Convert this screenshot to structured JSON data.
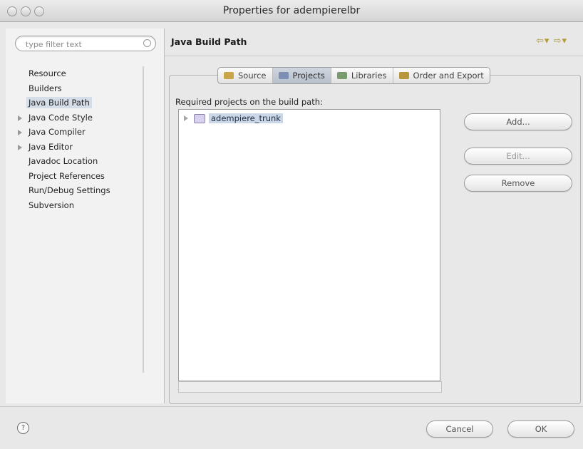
{
  "window": {
    "title": "Properties for adempierelbr"
  },
  "filter": {
    "placeholder": "type filter text"
  },
  "tree": {
    "items": [
      {
        "label": "Resource",
        "expandable": false,
        "selected": false
      },
      {
        "label": "Builders",
        "expandable": false,
        "selected": false
      },
      {
        "label": "Java Build Path",
        "expandable": false,
        "selected": true
      },
      {
        "label": "Java Code Style",
        "expandable": true,
        "selected": false
      },
      {
        "label": "Java Compiler",
        "expandable": true,
        "selected": false
      },
      {
        "label": "Java Editor",
        "expandable": true,
        "selected": false
      },
      {
        "label": "Javadoc Location",
        "expandable": false,
        "selected": false
      },
      {
        "label": "Project References",
        "expandable": false,
        "selected": false
      },
      {
        "label": "Run/Debug Settings",
        "expandable": false,
        "selected": false
      },
      {
        "label": "Subversion",
        "expandable": false,
        "selected": false
      }
    ]
  },
  "page": {
    "title": "Java Build Path",
    "nav_back": "⇦▾",
    "nav_forward": "⇨▾"
  },
  "tabs": [
    {
      "label": "Source",
      "icon": "source-folder-icon",
      "active": false
    },
    {
      "label": "Projects",
      "icon": "projects-icon",
      "active": true
    },
    {
      "label": "Libraries",
      "icon": "libraries-icon",
      "active": false
    },
    {
      "label": "Order and Export",
      "icon": "order-export-icon",
      "active": false
    }
  ],
  "projects": {
    "label": "Required projects on the build path:",
    "items": [
      {
        "label": "adempiere_trunk"
      }
    ]
  },
  "buttons": {
    "add": "Add...",
    "edit": "Edit...",
    "remove": "Remove",
    "cancel": "Cancel",
    "ok": "OK",
    "help": "?"
  },
  "colors": {
    "selection": "#cbd6e6",
    "accent": "#b59b3a"
  }
}
